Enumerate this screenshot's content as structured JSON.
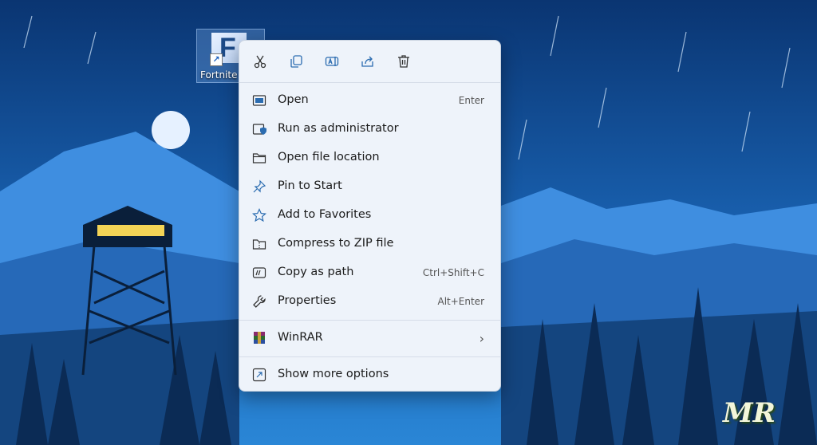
{
  "desktop": {
    "shortcut_label": "Fortnite",
    "watermark": "MR"
  },
  "context_menu": {
    "quick_actions": [
      {
        "name": "cut",
        "icon": "scissors-icon"
      },
      {
        "name": "copy",
        "icon": "copy-icon"
      },
      {
        "name": "rename",
        "icon": "rename-icon"
      },
      {
        "name": "share",
        "icon": "share-icon"
      },
      {
        "name": "delete",
        "icon": "trash-icon"
      }
    ],
    "items": [
      {
        "label": "Open",
        "shortcut": "Enter",
        "icon": "open-window-icon"
      },
      {
        "label": "Run as administrator",
        "shortcut": "",
        "icon": "shield-window-icon"
      },
      {
        "label": "Open file location",
        "shortcut": "",
        "icon": "folder-icon"
      },
      {
        "label": "Pin to Start",
        "shortcut": "",
        "icon": "pin-icon"
      },
      {
        "label": "Add to Favorites",
        "shortcut": "",
        "icon": "star-icon"
      },
      {
        "label": "Compress to ZIP file",
        "shortcut": "",
        "icon": "zip-icon"
      },
      {
        "label": "Copy as path",
        "shortcut": "Ctrl+Shift+C",
        "icon": "copy-path-icon"
      },
      {
        "label": "Properties",
        "shortcut": "Alt+Enter",
        "icon": "wrench-icon"
      },
      {
        "label": "WinRAR",
        "shortcut": "",
        "icon": "winrar-icon"
      },
      {
        "label": "Show more options",
        "shortcut": "",
        "icon": "expand-icon"
      }
    ]
  },
  "colors": {
    "sky": "#0c3f7d",
    "menu_bg": "#eef3fa",
    "icon_blue": "#2b6cb0"
  }
}
